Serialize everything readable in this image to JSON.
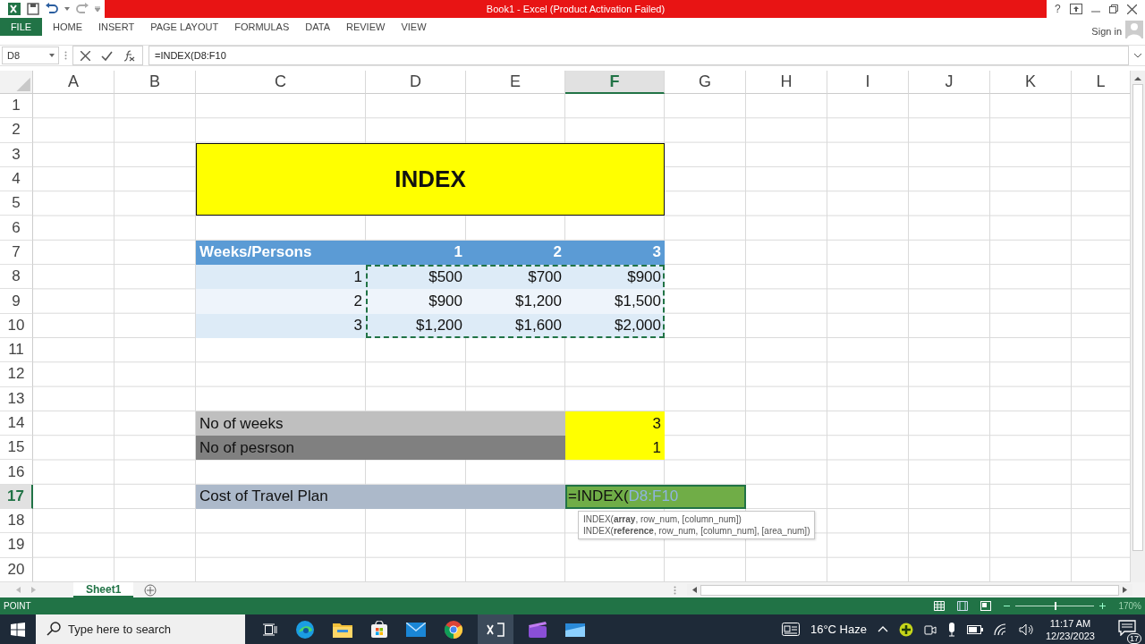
{
  "window": {
    "title": "Book1 -  Excel (Product Activation Failed)",
    "help": "?"
  },
  "ribbon_tabs": [
    {
      "label": "FILE",
      "kind": "file"
    },
    {
      "label": "HOME",
      "kind": "tab"
    },
    {
      "label": "INSERT",
      "kind": "tab"
    },
    {
      "label": "PAGE LAYOUT",
      "kind": "tab"
    },
    {
      "label": "FORMULAS",
      "kind": "tab"
    },
    {
      "label": "DATA",
      "kind": "tab"
    },
    {
      "label": "REVIEW",
      "kind": "tab"
    },
    {
      "label": "VIEW",
      "kind": "tab"
    }
  ],
  "sign_in": "Sign in",
  "formula_bar": {
    "name_box": "D8",
    "formula": "=INDEX(D8:F10"
  },
  "columns": [
    {
      "label": "A",
      "selected": false
    },
    {
      "label": "B",
      "selected": false
    },
    {
      "label": "C",
      "selected": false
    },
    {
      "label": "D",
      "selected": false
    },
    {
      "label": "E",
      "selected": false
    },
    {
      "label": "F",
      "selected": true
    },
    {
      "label": "G",
      "selected": false
    },
    {
      "label": "H",
      "selected": false
    },
    {
      "label": "I",
      "selected": false
    },
    {
      "label": "J",
      "selected": false
    },
    {
      "label": "K",
      "selected": false
    },
    {
      "label": "L",
      "selected": false
    }
  ],
  "rows": [
    {
      "label": "1",
      "selected": false
    },
    {
      "label": "2",
      "selected": false
    },
    {
      "label": "3",
      "selected": false
    },
    {
      "label": "4",
      "selected": false
    },
    {
      "label": "5",
      "selected": false
    },
    {
      "label": "6",
      "selected": false
    },
    {
      "label": "7",
      "selected": false
    },
    {
      "label": "8",
      "selected": false
    },
    {
      "label": "9",
      "selected": false
    },
    {
      "label": "10",
      "selected": false
    },
    {
      "label": "11",
      "selected": false
    },
    {
      "label": "12",
      "selected": false
    },
    {
      "label": "13",
      "selected": false
    },
    {
      "label": "14",
      "selected": false
    },
    {
      "label": "15",
      "selected": false
    },
    {
      "label": "16",
      "selected": false
    },
    {
      "label": "17",
      "selected": true
    },
    {
      "label": "18",
      "selected": false
    },
    {
      "label": "19",
      "selected": false
    },
    {
      "label": "20",
      "selected": false
    }
  ],
  "title_cell": "INDEX",
  "table": {
    "header": [
      "Weeks/Persons",
      "1",
      "2",
      "3"
    ],
    "rows": [
      [
        "1",
        "$500",
        "$700",
        "$900"
      ],
      [
        "2",
        "$900",
        "$1,200",
        "$1,500"
      ],
      [
        "3",
        "$1,200",
        "$1,600",
        "$2,000"
      ]
    ],
    "copy_marquee": true
  },
  "inputs": [
    {
      "label": "No of weeks",
      "value": "3",
      "kind": "light"
    },
    {
      "label": "No of pesrson",
      "value": "1",
      "kind": "dark"
    }
  ],
  "result_label": "Cost of Travel Plan",
  "editor": {
    "text": "=INDEX(",
    "reference": "D8:F10"
  },
  "tooltip": [
    "INDEX(**array**, row_num, [column_num])",
    "INDEX(**reference**, row_num, [column_num], [area_num])"
  ],
  "sheet_tabs": [
    {
      "label": "Sheet1",
      "selected": true
    }
  ],
  "status_bar": {
    "mode": "POINT",
    "zoom": "170%",
    "level": 0.5
  },
  "taskbar": {
    "search_placeholder": "Type here to search",
    "weather": "16°C Haze",
    "time": "11:17 AM",
    "date": "12/23/2023",
    "notifications": "17"
  }
}
